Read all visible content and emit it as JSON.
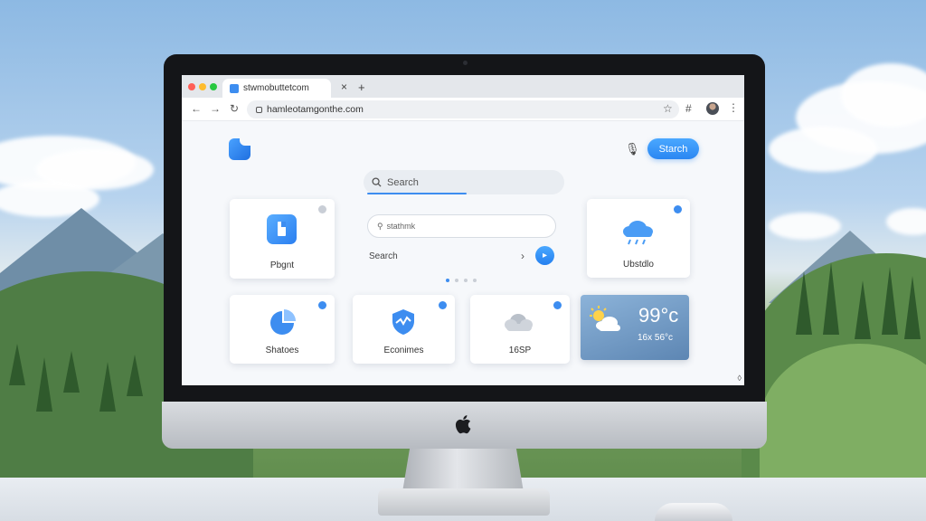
{
  "browser": {
    "tab_title": "stwmobuttetcom",
    "tab_close": "×",
    "new_tab": "+",
    "url": "hamleotamgonthe.com",
    "back": "←",
    "forward": "→",
    "reload": "↻",
    "star": "☆",
    "extension": "#",
    "menu": "⋮"
  },
  "header": {
    "search_button": "Starch",
    "mic": "🎙"
  },
  "main_search": {
    "placeholder": "Search"
  },
  "center_panel": {
    "inner_placeholder": "stathmk",
    "search_label": "Search",
    "chevron": "›",
    "go": "▸"
  },
  "cards": {
    "pingnt": "Pbgnt",
    "weather_top": "Ubstdlo",
    "shatoes": "Shatoes",
    "econimes": "Econimes",
    "cloud": "16SP"
  },
  "weather": {
    "temp": "99°c",
    "sub": "16x 56°c"
  },
  "colors": {
    "accent": "#3d8df0",
    "dot_red": "#ff5f57",
    "dot_yellow": "#febc2e",
    "dot_green": "#28c840"
  }
}
